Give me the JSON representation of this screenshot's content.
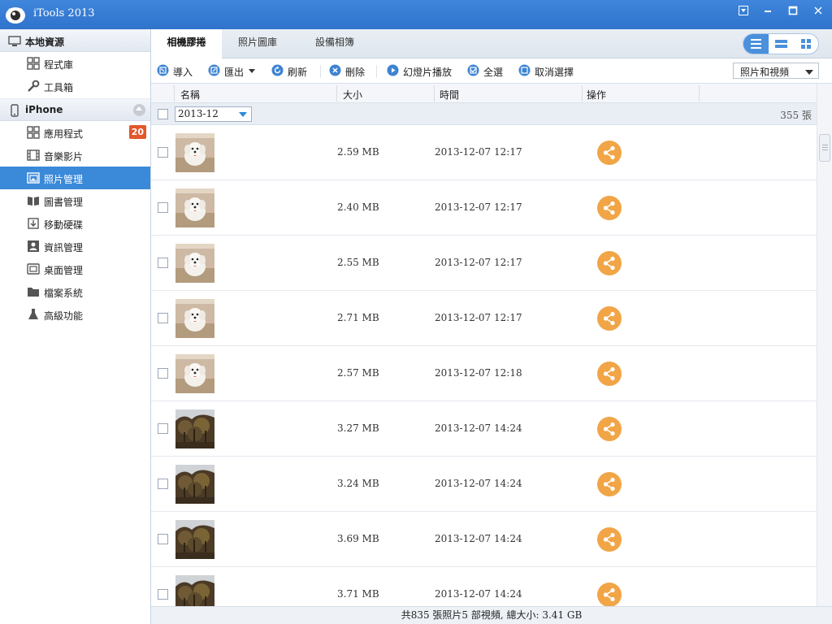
{
  "window": {
    "title": "iTools 2013"
  },
  "sidebar": {
    "local_header": "本地資源",
    "local_items": [
      {
        "label": "程式庫",
        "icon": "grid-icon"
      },
      {
        "label": "工具箱",
        "icon": "wrench-icon"
      }
    ],
    "device_header": "iPhone",
    "device_items": [
      {
        "label": "應用程式",
        "icon": "grid-icon",
        "badge": "20"
      },
      {
        "label": "音樂影片",
        "icon": "film-icon"
      },
      {
        "label": "照片管理",
        "icon": "photo-icon",
        "active": true
      },
      {
        "label": "圖書管理",
        "icon": "book-icon"
      },
      {
        "label": "移動硬碟",
        "icon": "usb-drive-icon"
      },
      {
        "label": "資訊管理",
        "icon": "contact-card-icon"
      },
      {
        "label": "桌面管理",
        "icon": "desktop-icon"
      },
      {
        "label": "檔案系統",
        "icon": "folder-icon"
      },
      {
        "label": "高級功能",
        "icon": "flask-icon"
      }
    ]
  },
  "tabs": [
    {
      "label": "相機膠捲",
      "active": true
    },
    {
      "label": "照片圖庫"
    },
    {
      "label": "設備相簿"
    }
  ],
  "toolbar": {
    "import": "導入",
    "export": "匯出",
    "refresh": "刷新",
    "delete": "刪除",
    "slideshow": "幻燈片播放",
    "select_all": "全選",
    "deselect": "取消選擇",
    "filter_value": "照片和視頻"
  },
  "columns": {
    "name": "名稱",
    "size": "大小",
    "time": "時間",
    "action": "操作"
  },
  "group": {
    "date": "2013-12",
    "count": "355 張"
  },
  "rows": [
    {
      "size": "2.59 MB",
      "time": "2013-12-07 12:17",
      "kind": "dog"
    },
    {
      "size": "2.40 MB",
      "time": "2013-12-07 12:17",
      "kind": "dog"
    },
    {
      "size": "2.55 MB",
      "time": "2013-12-07 12:17",
      "kind": "dog"
    },
    {
      "size": "2.71 MB",
      "time": "2013-12-07 12:17",
      "kind": "dog"
    },
    {
      "size": "2.57 MB",
      "time": "2013-12-07 12:18",
      "kind": "dog"
    },
    {
      "size": "3.27 MB",
      "time": "2013-12-07 14:24",
      "kind": "tree"
    },
    {
      "size": "3.24 MB",
      "time": "2013-12-07 14:24",
      "kind": "tree"
    },
    {
      "size": "3.69 MB",
      "time": "2013-12-07 14:24",
      "kind": "tree"
    },
    {
      "size": "3.71 MB",
      "time": "2013-12-07 14:24",
      "kind": "tree"
    }
  ],
  "status": "共835 張照片5 部視頻, 總大小: 3.41 GB",
  "colors": {
    "accent": "#3b8ad9",
    "titlebar": "#3a7fd6",
    "share": "#f1a547",
    "badge": "#e2572b"
  }
}
